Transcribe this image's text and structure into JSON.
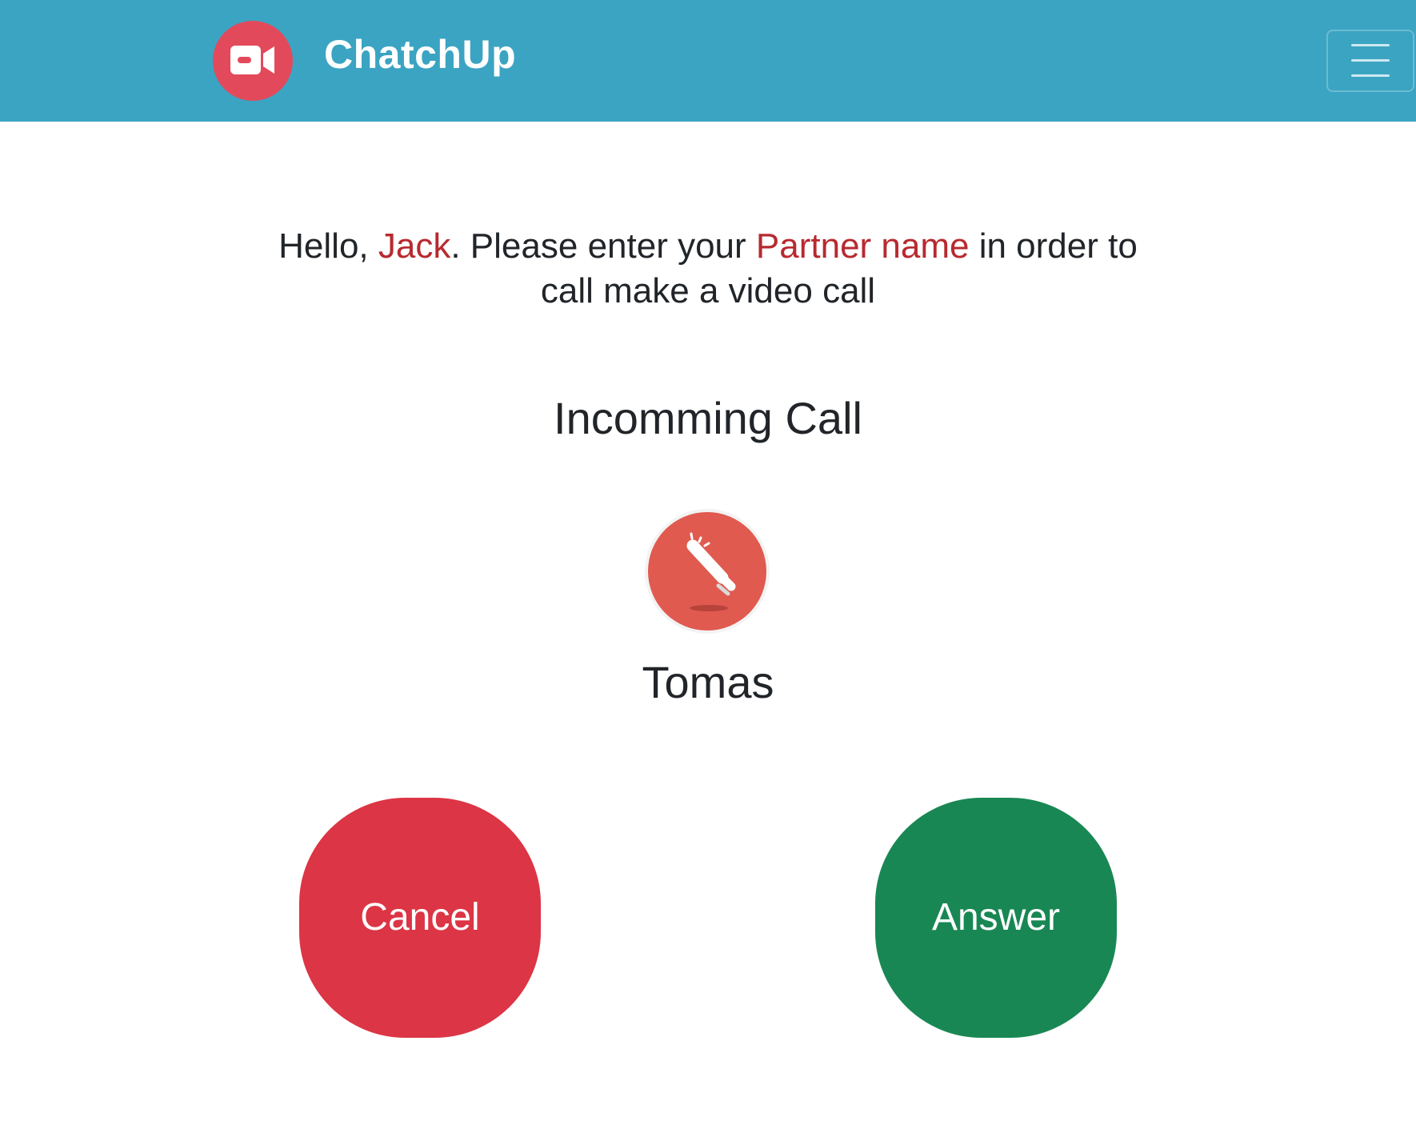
{
  "header": {
    "app_name": "ChatchUp",
    "logo_icon": "video-camera-icon",
    "menu_icon": "hamburger-menu-icon",
    "background_color": "#3ba4c2"
  },
  "greeting": {
    "prefix": "Hello, ",
    "user_name": "Jack",
    "middle": ". Please enter your ",
    "partner_label": "Partner name",
    "suffix": " in order to call make a video call",
    "highlight_color": "#b72a30"
  },
  "call": {
    "title": "Incomming Call",
    "caller_icon": "ringing-phone-icon",
    "caller_name": "Tomas"
  },
  "actions": {
    "cancel_label": "Cancel",
    "cancel_color": "#dc3545",
    "answer_label": "Answer",
    "answer_color": "#198754"
  }
}
